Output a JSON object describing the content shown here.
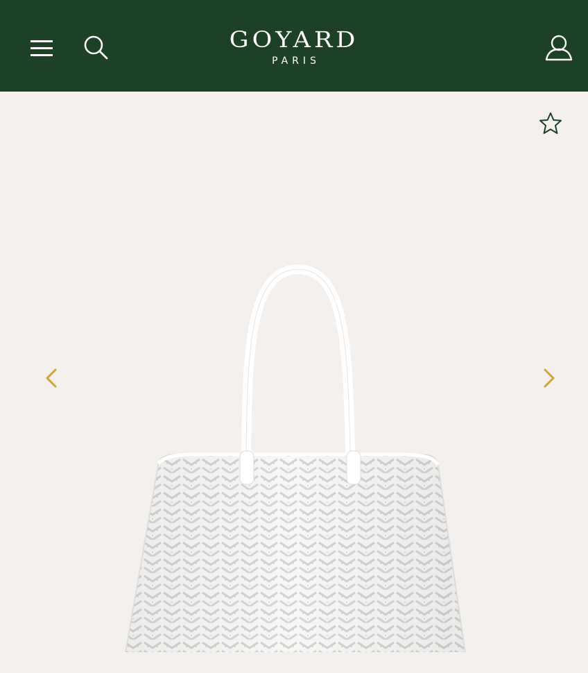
{
  "header": {
    "brand": "GOYARD",
    "brand_sub": "PARIS",
    "menu_icon": "hamburger-menu-icon",
    "search_icon": "search-icon",
    "account_icon": "user-account-icon",
    "background_color": "#1c4127"
  },
  "gallery": {
    "favorite_icon": "star-outline-icon",
    "prev_icon": "chevron-left-icon",
    "next_icon": "chevron-right-icon",
    "arrow_color": "#d4a23a",
    "product_image": "white-goyard-chevron-tote-bag",
    "background_color": "#f3f0ee"
  }
}
